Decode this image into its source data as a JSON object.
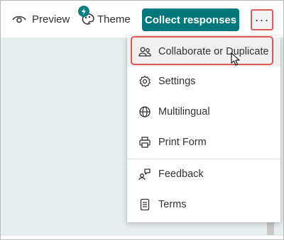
{
  "toolbar": {
    "preview_label": "Preview",
    "theme_label": "Theme",
    "collect_label": "Collect responses",
    "more_label": "···"
  },
  "menu": {
    "items": [
      {
        "label": "Collaborate or Duplicate",
        "icon": "people-icon"
      },
      {
        "label": "Settings",
        "icon": "gear-icon"
      },
      {
        "label": "Multilingual",
        "icon": "globe-icon"
      },
      {
        "label": "Print Form",
        "icon": "printer-icon"
      },
      {
        "label": "Feedback",
        "icon": "feedback-icon"
      },
      {
        "label": "Terms",
        "icon": "document-icon"
      }
    ]
  },
  "colors": {
    "accent": "#03787c",
    "highlight": "#e05858",
    "canvas": "#e6eef0"
  }
}
